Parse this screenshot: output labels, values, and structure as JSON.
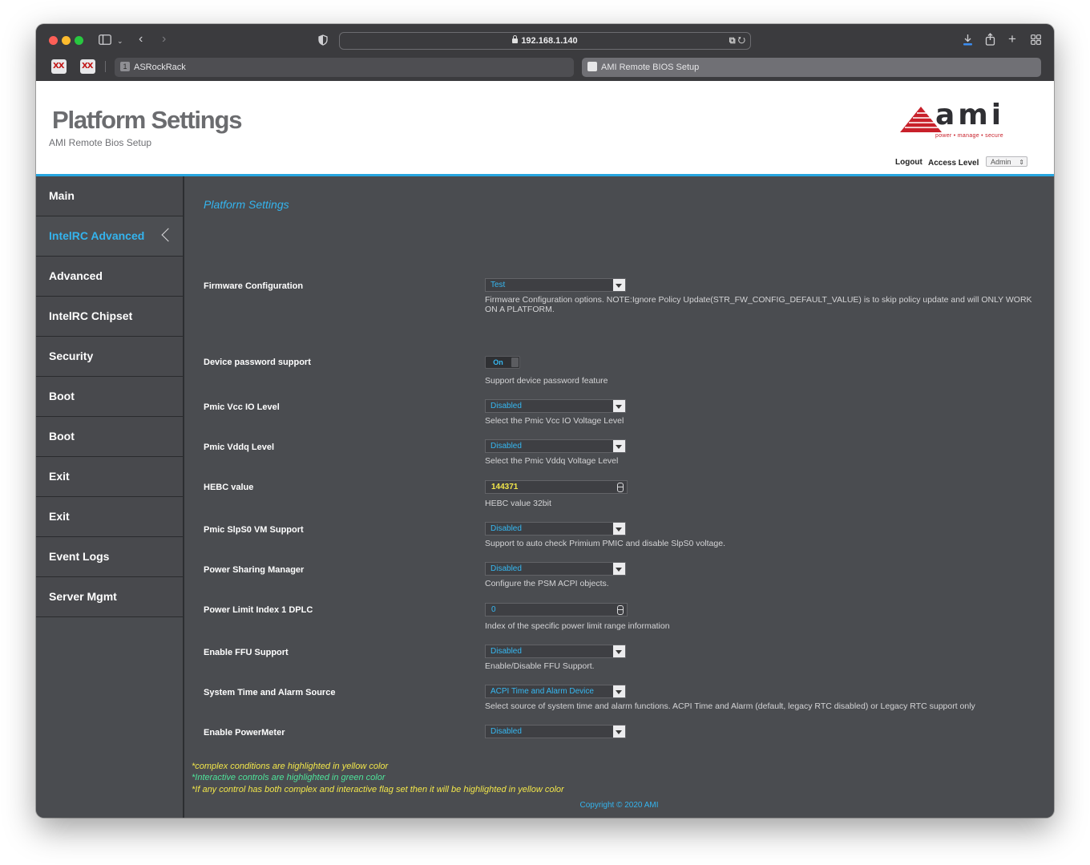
{
  "browser": {
    "url": "192.168.1.140",
    "tabs": [
      {
        "index": "1",
        "label": "ASRockRack"
      },
      {
        "label": "AMI Remote BIOS Setup"
      }
    ]
  },
  "header": {
    "title": "Platform Settings",
    "subtitle": "AMI Remote Bios Setup",
    "logo_text": "ami",
    "logo_tagline": "power • manage • secure",
    "logout_label": "Logout",
    "access_level_label": "Access Level",
    "access_level_value": "Admin"
  },
  "sidebar": {
    "items": [
      {
        "label": "Main"
      },
      {
        "label": "IntelRC Advanced"
      },
      {
        "label": "Advanced"
      },
      {
        "label": "IntelRC Chipset"
      },
      {
        "label": "Security"
      },
      {
        "label": "Boot"
      },
      {
        "label": "Boot"
      },
      {
        "label": "Exit"
      },
      {
        "label": "Exit"
      },
      {
        "label": "Event Logs"
      },
      {
        "label": "Server Mgmt"
      }
    ],
    "active_index": 1
  },
  "content": {
    "section_title": "Platform Settings",
    "settings": [
      {
        "label": "Firmware Configuration",
        "value": "Test",
        "help": "Firmware Configuration options. NOTE:Ignore Policy Update(STR_FW_CONFIG_DEFAULT_VALUE) is to skip policy update and will ONLY WORK ON A PLATFORM."
      },
      {
        "label": "Device password support",
        "value": "On",
        "help": "Support device password feature"
      },
      {
        "label": "Pmic Vcc IO Level",
        "value": "Disabled",
        "help": "Select the Pmic Vcc IO Voltage Level"
      },
      {
        "label": "Pmic Vddq Level",
        "value": "Disabled",
        "help": "Select the Pmic Vddq Voltage Level"
      },
      {
        "label": "HEBC value",
        "value": "144371",
        "help": "HEBC value 32bit"
      },
      {
        "label": "Pmic SlpS0 VM Support",
        "value": "Disabled",
        "help": "Support to auto check Primium PMIC and disable SlpS0 voltage."
      },
      {
        "label": "Power Sharing Manager",
        "value": "Disabled",
        "help": "Configure the PSM ACPI objects."
      },
      {
        "label": "Power Limit Index 1 DPLC",
        "value": "0",
        "help": "Index of the specific power limit range information"
      },
      {
        "label": "Enable FFU Support",
        "value": "Disabled",
        "help": "Enable/Disable FFU Support."
      },
      {
        "label": "System Time and Alarm Source",
        "value": "ACPI Time and Alarm Device",
        "help": "Select source of system time and alarm functions. ACPI Time and Alarm (default, legacy RTC disabled) or Legacy RTC support only"
      },
      {
        "label": "Enable PowerMeter",
        "value": "Disabled",
        "help": ""
      }
    ],
    "legend": [
      "*complex conditions are highlighted in yellow color",
      "*Interactive controls are highlighted in green color",
      "*If any control has both complex and interactive flag set then it will be highlighted in yellow color"
    ],
    "copyright": "Copyright © 2020 AMI"
  },
  "colors": {
    "accent": "#34b4ee",
    "complex_highlight": "#f2e64a",
    "interactive_highlight": "#4ee39a",
    "content_bg": "#4a4c50"
  }
}
